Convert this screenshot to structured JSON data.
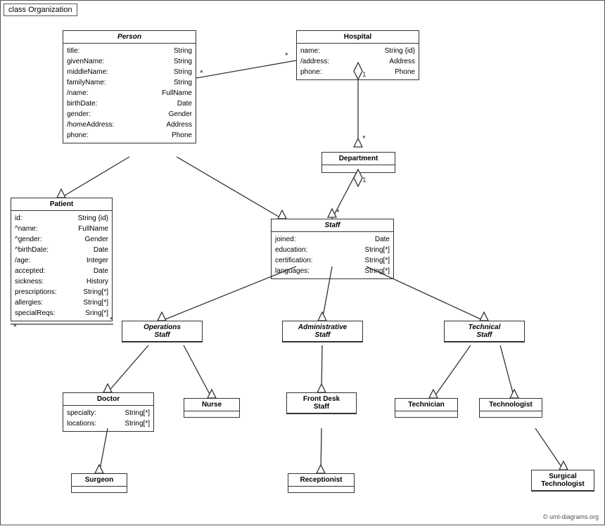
{
  "diagram": {
    "title": "class Organization",
    "copyright": "© uml-diagrams.org",
    "classes": {
      "person": {
        "name": "Person",
        "italic": true,
        "attributes": [
          {
            "attr": "title:",
            "type": "String"
          },
          {
            "attr": "givenName:",
            "type": "String"
          },
          {
            "attr": "middleName:",
            "type": "String"
          },
          {
            "attr": "familyName:",
            "type": "String"
          },
          {
            "attr": "/name:",
            "type": "FullName"
          },
          {
            "attr": "birthDate:",
            "type": "Date"
          },
          {
            "attr": "gender:",
            "type": "Gender"
          },
          {
            "attr": "/homeAddress:",
            "type": "Address"
          },
          {
            "attr": "phone:",
            "type": "Phone"
          }
        ]
      },
      "hospital": {
        "name": "Hospital",
        "italic": false,
        "attributes": [
          {
            "attr": "name:",
            "type": "String {id}"
          },
          {
            "attr": "/address:",
            "type": "Address"
          },
          {
            "attr": "phone:",
            "type": "Phone"
          }
        ]
      },
      "department": {
        "name": "Department",
        "italic": false,
        "attributes": []
      },
      "patient": {
        "name": "Patient",
        "italic": false,
        "attributes": [
          {
            "attr": "id:",
            "type": "String {id}"
          },
          {
            "attr": "^name:",
            "type": "FullName"
          },
          {
            "attr": "^gender:",
            "type": "Gender"
          },
          {
            "attr": "^birthDate:",
            "type": "Date"
          },
          {
            "attr": "/age:",
            "type": "Integer"
          },
          {
            "attr": "accepted:",
            "type": "Date"
          },
          {
            "attr": "sickness:",
            "type": "History"
          },
          {
            "attr": "prescriptions:",
            "type": "String[*]"
          },
          {
            "attr": "allergies:",
            "type": "String[*]"
          },
          {
            "attr": "specialReqs:",
            "type": "Sring[*]"
          }
        ]
      },
      "staff": {
        "name": "Staff",
        "italic": true,
        "attributes": [
          {
            "attr": "joined:",
            "type": "Date"
          },
          {
            "attr": "education:",
            "type": "String[*]"
          },
          {
            "attr": "certification:",
            "type": "String[*]"
          },
          {
            "attr": "languages:",
            "type": "String[*]"
          }
        ]
      },
      "operations_staff": {
        "name": "Operations\nStaff",
        "italic": true
      },
      "administrative_staff": {
        "name": "Administrative\nStaff",
        "italic": true
      },
      "technical_staff": {
        "name": "Technical\nStaff",
        "italic": true
      },
      "doctor": {
        "name": "Doctor",
        "italic": false,
        "attributes": [
          {
            "attr": "specialty:",
            "type": "String[*]"
          },
          {
            "attr": "locations:",
            "type": "String[*]"
          }
        ]
      },
      "nurse": {
        "name": "Nurse",
        "italic": false,
        "attributes": []
      },
      "front_desk_staff": {
        "name": "Front Desk\nStaff",
        "italic": false,
        "attributes": []
      },
      "technician": {
        "name": "Technician",
        "italic": false,
        "attributes": []
      },
      "technologist": {
        "name": "Technologist",
        "italic": false,
        "attributes": []
      },
      "surgeon": {
        "name": "Surgeon",
        "italic": false,
        "attributes": []
      },
      "receptionist": {
        "name": "Receptionist",
        "italic": false,
        "attributes": []
      },
      "surgical_technologist": {
        "name": "Surgical\nTechnologist",
        "italic": false,
        "attributes": []
      }
    }
  }
}
